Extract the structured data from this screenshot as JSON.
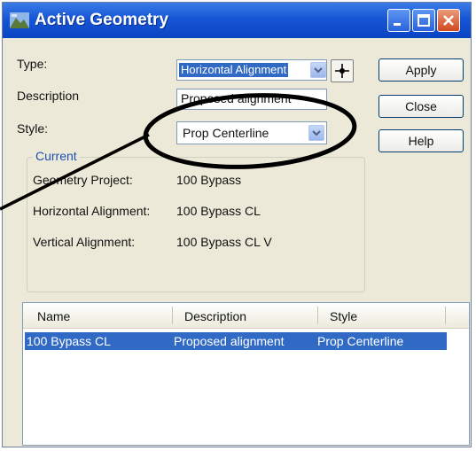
{
  "window": {
    "title": "Active Geometry"
  },
  "form": {
    "type_label": "Type:",
    "type_value": "Horizontal Alignment",
    "description_label": "Description",
    "description_value": "Proposed alignment",
    "style_label": "Style:",
    "style_value": "Prop Centerline"
  },
  "buttons": {
    "apply": "Apply",
    "close": "Close",
    "help": "Help"
  },
  "current": {
    "legend": "Current",
    "rows": [
      {
        "label": "Geometry Project:",
        "value": "100 Bypass"
      },
      {
        "label": "Horizontal Alignment:",
        "value": "100 Bypass CL"
      },
      {
        "label": "Vertical Alignment:",
        "value": "100 Bypass CL V"
      }
    ]
  },
  "list": {
    "columns": [
      "Name",
      "Description",
      "Style"
    ],
    "rows": [
      {
        "name": "100 Bypass CL",
        "description": "Proposed alignment",
        "style": "Prop Centerline",
        "selected": true
      }
    ]
  },
  "colors": {
    "titlebar": "#1656d6",
    "selection": "#316ac5",
    "dialog_bg": "#ece9d8",
    "callout": "#000000"
  }
}
